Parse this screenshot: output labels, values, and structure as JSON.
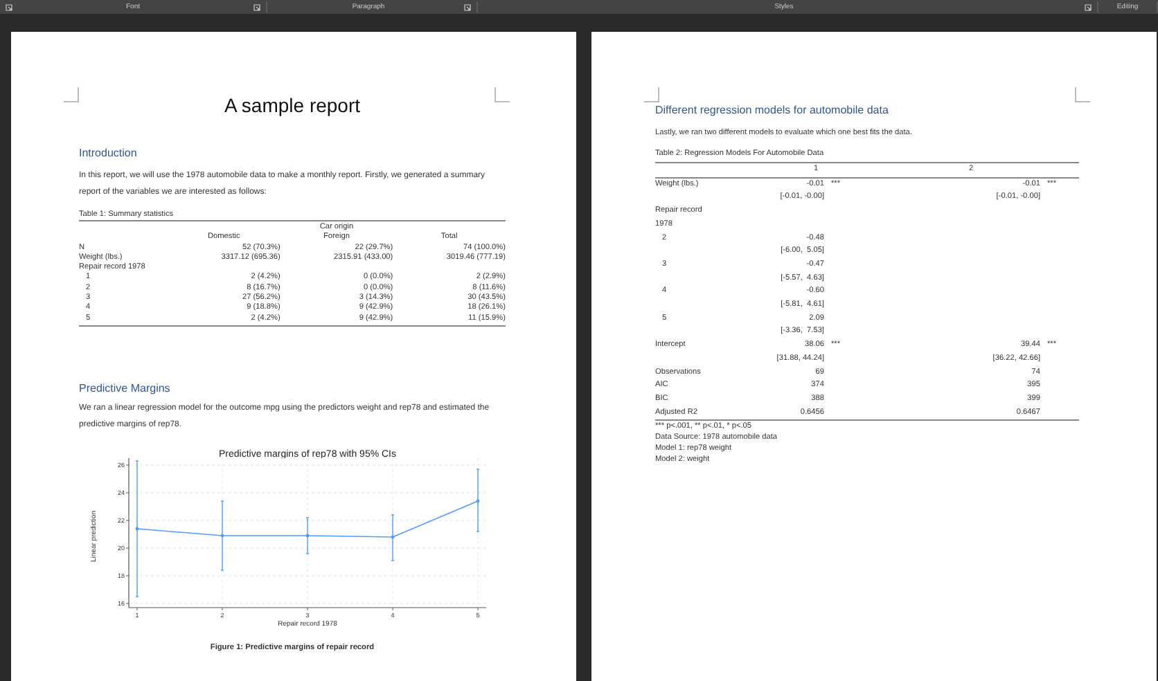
{
  "ribbon": {
    "groups": [
      {
        "label": "Font",
        "launcher": true
      },
      {
        "label": "Paragraph",
        "launcher": true
      },
      {
        "label": "Styles",
        "launcher": true
      },
      {
        "label": "Editing",
        "launcher": false
      }
    ],
    "leading_launcher": true
  },
  "left_page": {
    "title": "A sample report",
    "intro_heading": "Introduction",
    "intro_text": "In this report, we will use the 1978 automobile data to make a monthly report. Firstly, we generated a summary report of the variables we are interested as follows:",
    "table1": {
      "caption": "Table 1: Summary statistics",
      "spanner": "Car origin",
      "columns": [
        "Domestic",
        "Foreign",
        "Total"
      ],
      "rows": [
        {
          "label": "N",
          "indented": false,
          "cells": [
            "52 (70.3%)",
            "22 (29.7%)",
            "74 (100.0%)"
          ]
        },
        {
          "label": "Weight (lbs.)",
          "indented": false,
          "cells": [
            "3317.12 (695.36)",
            "2315.91 (433.00)",
            "3019.46 (777.19)"
          ]
        },
        {
          "label": "Repair record 1978",
          "indented": false,
          "cells": []
        },
        {
          "label": "1",
          "indented": true,
          "cells": [
            "2 (4.2%)",
            "0 (0.0%)",
            "2 (2.9%)"
          ]
        },
        {
          "label": "2",
          "indented": true,
          "cells": [
            "8 (16.7%)",
            "0 (0.0%)",
            "8 (11.6%)"
          ]
        },
        {
          "label": "3",
          "indented": true,
          "cells": [
            "27 (56.2%)",
            "3 (14.3%)",
            "30 (43.5%)"
          ]
        },
        {
          "label": "4",
          "indented": true,
          "cells": [
            "9 (18.8%)",
            "9 (42.9%)",
            "18 (26.1%)"
          ]
        },
        {
          "label": "5",
          "indented": true,
          "cells": [
            "2 (4.2%)",
            "9 (42.9%)",
            "11 (15.9%)"
          ]
        }
      ]
    },
    "margins_heading": "Predictive Margins",
    "margins_text": "We ran a linear regression model for the outcome mpg using the predictors weight and rep78 and estimated the predictive margins of rep78.",
    "chart_data": {
      "type": "line",
      "title": "Predictive margins of rep78 with 95% CIs",
      "xlabel": "Repair record 1978",
      "ylabel": "Linear prediction",
      "categories": [
        "1",
        "2",
        "3",
        "4",
        "5"
      ],
      "series": [
        {
          "color": "#4f9cff",
          "values": [
            21.4,
            20.9,
            20.9,
            20.8,
            23.4
          ],
          "errors": [
            [
              16.5,
              26.3
            ],
            [
              18.4,
              23.4
            ],
            [
              19.6,
              22.2
            ],
            [
              19.1,
              22.4
            ],
            [
              21.2,
              25.7
            ]
          ]
        }
      ],
      "ylim": [
        15.7,
        26.5
      ],
      "yticks": [
        16,
        18,
        20,
        22,
        24,
        26
      ],
      "grid": true
    },
    "figure_caption": "Figure 1: Predictive margins of repair record"
  },
  "right_page": {
    "heading": "Different regression models for automobile data",
    "text": "Lastly, we ran two different models to evaluate which one best fits the data.",
    "table2": {
      "caption": "Table 2: Regression Models For Automobile Data",
      "columns": [
        "1",
        "2"
      ],
      "rows": [
        {
          "label": "Weight (lbs.)",
          "indented": false,
          "m1": "-0.01",
          "s1": "***",
          "m2": "-0.01",
          "s2": "***"
        },
        {
          "m1": "[-0.01, -0.00]",
          "m2": "[-0.01, -0.00]"
        },
        {
          "label": "Repair record",
          "indented": false
        },
        {
          "label": "1978",
          "indented": false
        },
        {
          "label": "2",
          "indented": true,
          "m1": "-0.48"
        },
        {
          "m1": "[-6.00,  5.05]"
        },
        {
          "label": "3",
          "indented": true,
          "m1": "-0.47"
        },
        {
          "m1": "[-5.57,  4.63]"
        },
        {
          "label": "4",
          "indented": true,
          "m1": "-0.60"
        },
        {
          "m1": "[-5.81,  4.61]"
        },
        {
          "label": "5",
          "indented": true,
          "m1": "2.09"
        },
        {
          "m1": "[-3.36,  7.53]"
        },
        {
          "label": "Intercept",
          "indented": false,
          "m1": "38.06",
          "s1": "***",
          "m2": "39.44",
          "s2": "***"
        },
        {
          "m1": "[31.88, 44.24]",
          "m2": "[36.22, 42.66]"
        },
        {
          "label": "Observations",
          "indented": false,
          "m1": "69",
          "m2": "74"
        },
        {
          "label": "AIC",
          "indented": false,
          "m1": "374",
          "m2": "395"
        },
        {
          "label": "BIC",
          "indented": false,
          "m1": "388",
          "m2": "399"
        },
        {
          "label": "Adjusted R2",
          "indented": false,
          "m1": "0.6456",
          "m2": "0.6467"
        }
      ],
      "notes": [
        "*** p<.001, ** p<.01, * p<.05",
        "Data Source: 1978 automobile data",
        "Model 1: rep78 weight",
        "Model 2: weight"
      ]
    }
  }
}
